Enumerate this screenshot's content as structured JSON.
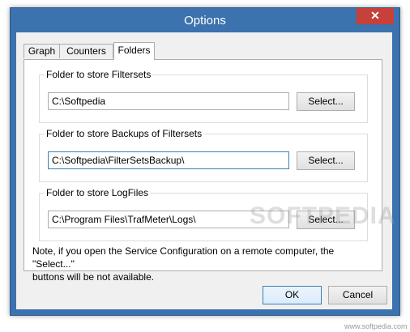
{
  "window": {
    "title": "Options",
    "close_glyph": "✕"
  },
  "tabs": [
    {
      "label": "Graph",
      "active": false
    },
    {
      "label": "Counters",
      "active": false
    },
    {
      "label": "Folders",
      "active": true
    }
  ],
  "groups": [
    {
      "label": "Folder to store Filtersets",
      "value": "C:\\Softpedia",
      "button": "Select..."
    },
    {
      "label": "Folder to store Backups of Filtersets",
      "value": "C:\\Softpedia\\FilterSetsBackup\\",
      "button": "Select..."
    },
    {
      "label": "Folder to store LogFiles",
      "value": "C:\\Program Files\\TrafMeter\\Logs\\",
      "button": "Select..."
    }
  ],
  "note": {
    "line1": "Note, if you open the Service Configuration on a remote computer, the \"Select...\"",
    "line2": "buttons will be not available."
  },
  "buttons": {
    "ok": "OK",
    "cancel": "Cancel"
  },
  "watermark": {
    "big": "SOFTPEDIA",
    "small": "www.softpedia.com"
  },
  "colors": {
    "title_bar": "#3c72ae",
    "close": "#c7403a",
    "focus_border": "#3c7fb1"
  }
}
